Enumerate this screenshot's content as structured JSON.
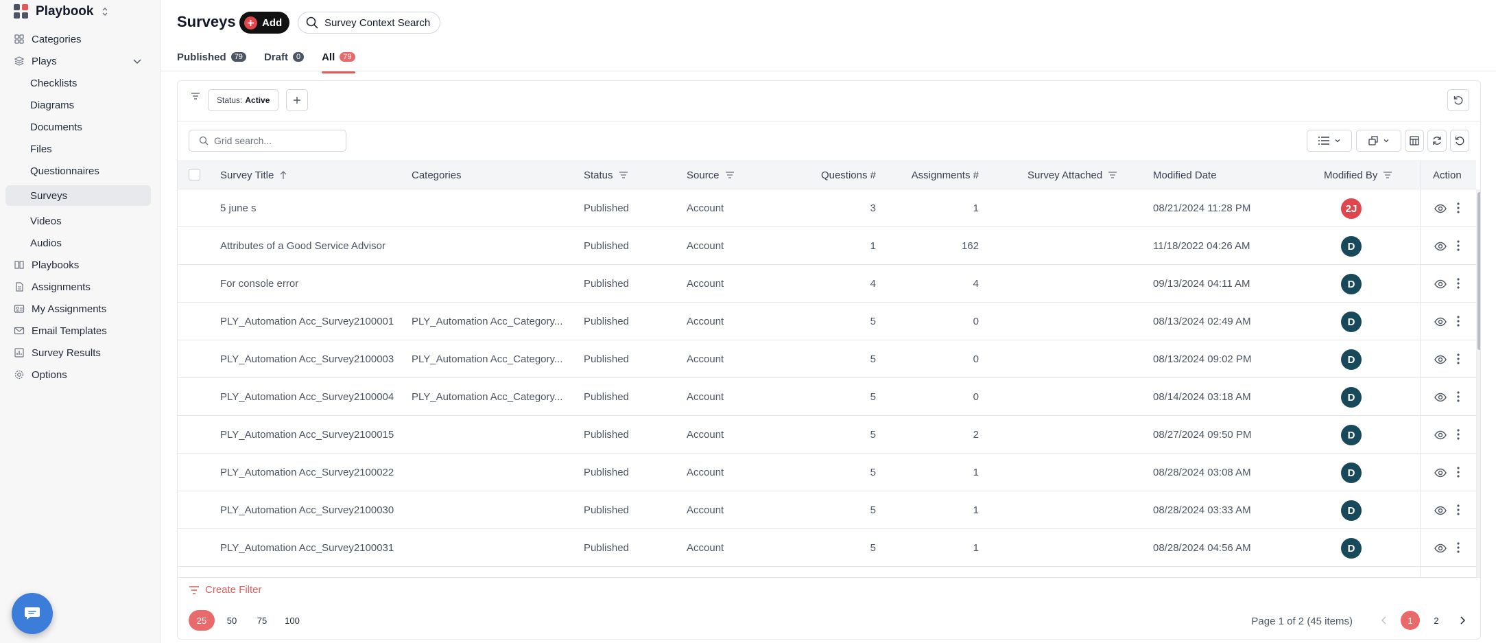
{
  "app": {
    "name": "Playbook"
  },
  "sidebar": {
    "items": [
      {
        "label": "Categories",
        "icon": "categories-icon"
      },
      {
        "label": "Plays",
        "icon": "layers-icon",
        "expanded": true
      },
      {
        "label": "Checklists",
        "sub": true
      },
      {
        "label": "Diagrams",
        "sub": true
      },
      {
        "label": "Documents",
        "sub": true
      },
      {
        "label": "Files",
        "sub": true
      },
      {
        "label": "Questionnaires",
        "sub": true
      },
      {
        "label": "Surveys",
        "sub": true,
        "active": true
      },
      {
        "label": "Videos",
        "sub": true
      },
      {
        "label": "Audios",
        "sub": true
      },
      {
        "label": "Playbooks",
        "icon": "book-icon"
      },
      {
        "label": "Assignments",
        "icon": "document-icon"
      },
      {
        "label": "My Assignments",
        "icon": "id-card-icon"
      },
      {
        "label": "Email Templates",
        "icon": "mail-icon"
      },
      {
        "label": "Survey Results",
        "icon": "bar-chart-icon"
      },
      {
        "label": "Options",
        "icon": "gear-icon"
      }
    ]
  },
  "header": {
    "title": "Surveys",
    "add_label": "Add",
    "context_search_label": "Survey Context Search"
  },
  "tabs": [
    {
      "label": "Published",
      "count": "79"
    },
    {
      "label": "Draft",
      "count": "0"
    },
    {
      "label": "All",
      "count": "79",
      "active": true
    }
  ],
  "filters": {
    "chip_key": "Status:",
    "chip_value": "Active"
  },
  "grid": {
    "search_placeholder": "Grid search...",
    "columns": {
      "title": "Survey Title",
      "categories": "Categories",
      "status": "Status",
      "source": "Source",
      "questions": "Questions #",
      "assignments": "Assignments #",
      "attached": "Survey Attached",
      "modified_date": "Modified Date",
      "modified_by": "Modified By",
      "action": "Action"
    },
    "rows": [
      {
        "title": "5 june s",
        "categories": "",
        "status": "Published",
        "source": "Account",
        "questions": "3",
        "assignments": "1",
        "attached": "",
        "modified_date": "08/21/2024 11:28 PM",
        "modified_by": "2J",
        "avatar_color": "#e0474c"
      },
      {
        "title": "Attributes of a Good Service Advisor",
        "categories": "",
        "status": "Published",
        "source": "Account",
        "questions": "1",
        "assignments": "162",
        "attached": "",
        "modified_date": "11/18/2022 04:26 AM",
        "modified_by": "D",
        "avatar_color": "#17495b"
      },
      {
        "title": "For console error",
        "categories": "",
        "status": "Published",
        "source": "Account",
        "questions": "4",
        "assignments": "4",
        "attached": "",
        "modified_date": "09/13/2024 04:11 AM",
        "modified_by": "D",
        "avatar_color": "#17495b"
      },
      {
        "title": "PLY_Automation Acc_Survey2100001",
        "categories": "PLY_Automation Acc_Category...",
        "status": "Published",
        "source": "Account",
        "questions": "5",
        "assignments": "0",
        "attached": "",
        "modified_date": "08/13/2024 02:49 AM",
        "modified_by": "D",
        "avatar_color": "#17495b"
      },
      {
        "title": "PLY_Automation Acc_Survey2100003",
        "categories": "PLY_Automation Acc_Category...",
        "status": "Published",
        "source": "Account",
        "questions": "5",
        "assignments": "0",
        "attached": "",
        "modified_date": "08/13/2024 09:02 PM",
        "modified_by": "D",
        "avatar_color": "#17495b"
      },
      {
        "title": "PLY_Automation Acc_Survey2100004",
        "categories": "PLY_Automation Acc_Category...",
        "status": "Published",
        "source": "Account",
        "questions": "5",
        "assignments": "0",
        "attached": "",
        "modified_date": "08/14/2024 03:18 AM",
        "modified_by": "D",
        "avatar_color": "#17495b"
      },
      {
        "title": "PLY_Automation Acc_Survey2100015",
        "categories": "",
        "status": "Published",
        "source": "Account",
        "questions": "5",
        "assignments": "2",
        "attached": "",
        "modified_date": "08/27/2024 09:50 PM",
        "modified_by": "D",
        "avatar_color": "#17495b"
      },
      {
        "title": "PLY_Automation Acc_Survey2100022",
        "categories": "",
        "status": "Published",
        "source": "Account",
        "questions": "5",
        "assignments": "1",
        "attached": "",
        "modified_date": "08/28/2024 03:08 AM",
        "modified_by": "D",
        "avatar_color": "#17495b"
      },
      {
        "title": "PLY_Automation Acc_Survey2100030",
        "categories": "",
        "status": "Published",
        "source": "Account",
        "questions": "5",
        "assignments": "1",
        "attached": "",
        "modified_date": "08/28/2024 03:33 AM",
        "modified_by": "D",
        "avatar_color": "#17495b"
      },
      {
        "title": "PLY_Automation Acc_Survey2100031",
        "categories": "",
        "status": "Published",
        "source": "Account",
        "questions": "5",
        "assignments": "1",
        "attached": "",
        "modified_date": "08/28/2024 04:56 AM",
        "modified_by": "D",
        "avatar_color": "#17495b"
      }
    ]
  },
  "footer": {
    "create_filter_label": "Create Filter",
    "page_sizes": [
      "25",
      "50",
      "75",
      "100"
    ],
    "page_size_active": "25",
    "page_info": "Page 1 of 2 (45 items)",
    "pages": [
      "1",
      "2"
    ],
    "current_page": "1"
  },
  "colors": {
    "accent": "#e05a5a",
    "add_button": "#111111",
    "avatar_default": "#17495b",
    "avatar_red": "#e0474c",
    "chat_button": "#3b7dd8"
  }
}
